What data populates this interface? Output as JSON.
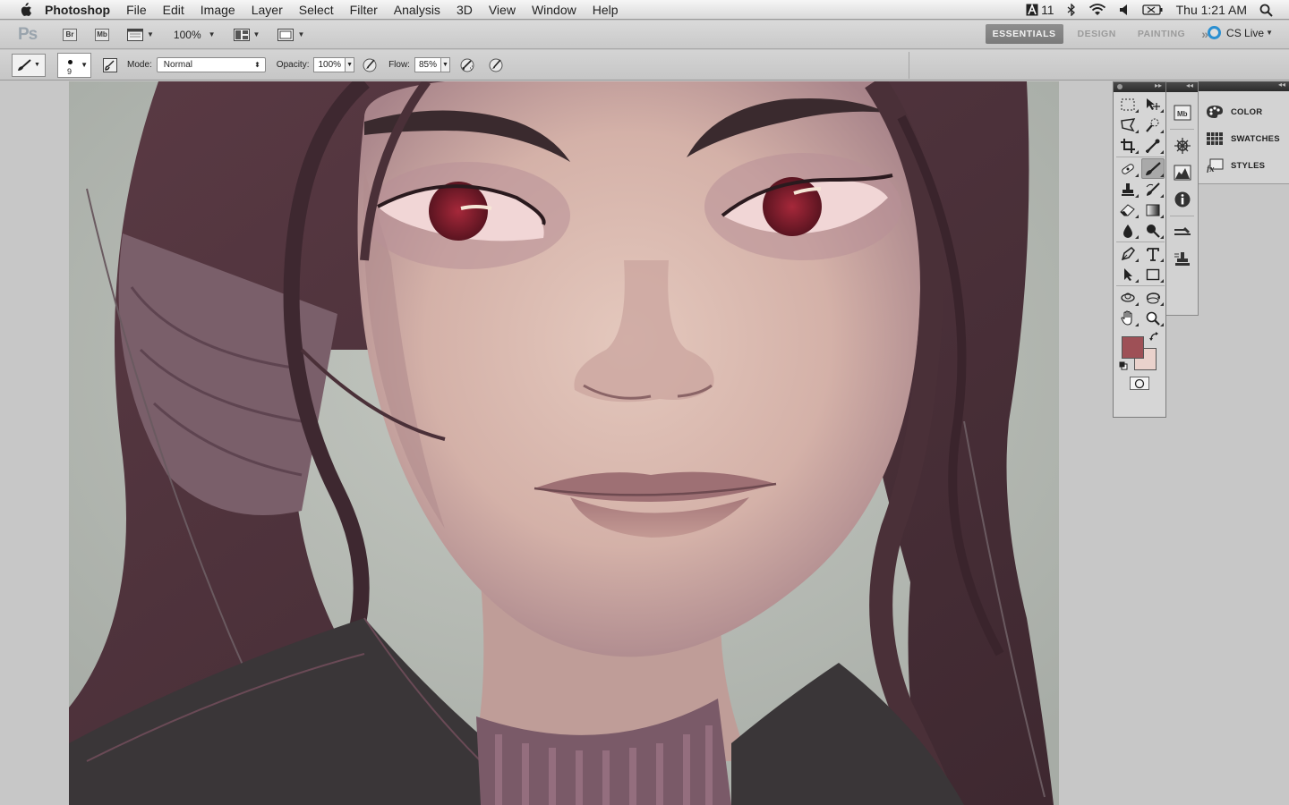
{
  "menubar": {
    "app_name": "Photoshop",
    "items": [
      "File",
      "Edit",
      "Image",
      "Layer",
      "Select",
      "Filter",
      "Analysis",
      "3D",
      "View",
      "Window",
      "Help"
    ],
    "status": {
      "adobe_badge": "11",
      "clock": "Thu 1:21 AM"
    }
  },
  "appbar": {
    "ps_logo": "Ps",
    "bridge_btn": "Br",
    "minibridge_btn": "Mb",
    "zoom": "100%",
    "workspaces": [
      "ESSENTIALS",
      "DESIGN",
      "PAINTING"
    ],
    "active_workspace": "ESSENTIALS",
    "more": "»",
    "cs_live": "CS Live"
  },
  "options": {
    "brush_size": "9",
    "mode_label": "Mode:",
    "mode_value": "Normal",
    "opacity_label": "Opacity:",
    "opacity_value": "100%",
    "flow_label": "Flow:",
    "flow_value": "85%"
  },
  "tools": {
    "foreground_color": "#9e5056",
    "background_color": "#ead2cc"
  },
  "panels": {
    "items": [
      "COLOR",
      "SWATCHES",
      "STYLES"
    ]
  },
  "colors": {
    "accent": "#2a8fd1",
    "workspace_active": "#7d7d7d"
  }
}
